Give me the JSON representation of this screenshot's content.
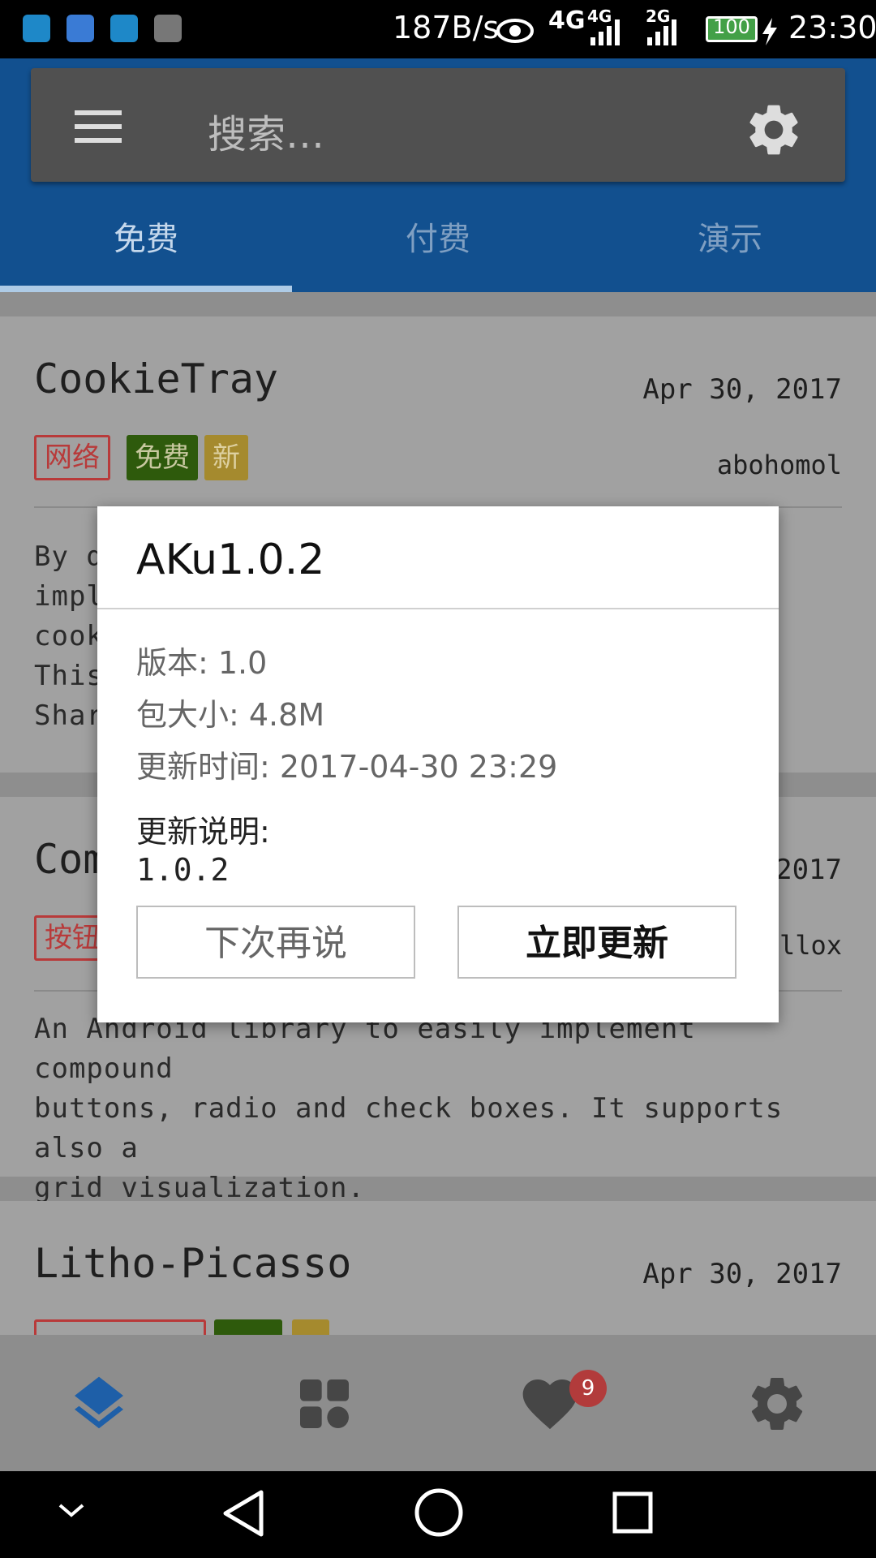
{
  "status_bar": {
    "net_speed": "187B/s",
    "network_1": "4G",
    "network_2": "4G",
    "network_3": "2G",
    "battery": "100",
    "time": "23:30"
  },
  "search": {
    "placeholder": "搜索…"
  },
  "tabs": [
    {
      "label": "免费",
      "active": true
    },
    {
      "label": "付费",
      "active": false
    },
    {
      "label": "演示",
      "active": false
    }
  ],
  "cards": [
    {
      "title": "CookieTray",
      "date": "Apr 30, 2017",
      "author": "abohomol",
      "tags": [
        "网络",
        "免费",
        "新"
      ],
      "description_lines": [
        "By d",
        "impl",
        "cook",
        "This",
        "Shar"
      ]
    },
    {
      "title": "Com",
      "date": "2017",
      "author": "ollox",
      "tags": [
        "按钮"
      ],
      "description_lines": [
        "An Android library to easily implement compound",
        "buttons, radio and check boxes. It supports also a",
        "grid visualization."
      ]
    },
    {
      "title": "Litho-Picasso",
      "date": "Apr 30, 2017"
    }
  ],
  "bottom_nav": {
    "items": [
      "layers-icon",
      "grid-icon",
      "heart-icon",
      "gear-icon"
    ],
    "favorites_badge": "9"
  },
  "dialog": {
    "title": "AKu1.0.2",
    "version": "版本: 1.0",
    "size": "包大小: 4.8M",
    "updated": "更新时间: 2017-04-30 23:29",
    "notes_label": "更新说明:",
    "notes": "1.0.2",
    "later_button": "下次再说",
    "update_button": "立即更新"
  },
  "colors": {
    "primary": "#1565c0",
    "accent": "#e53935"
  }
}
